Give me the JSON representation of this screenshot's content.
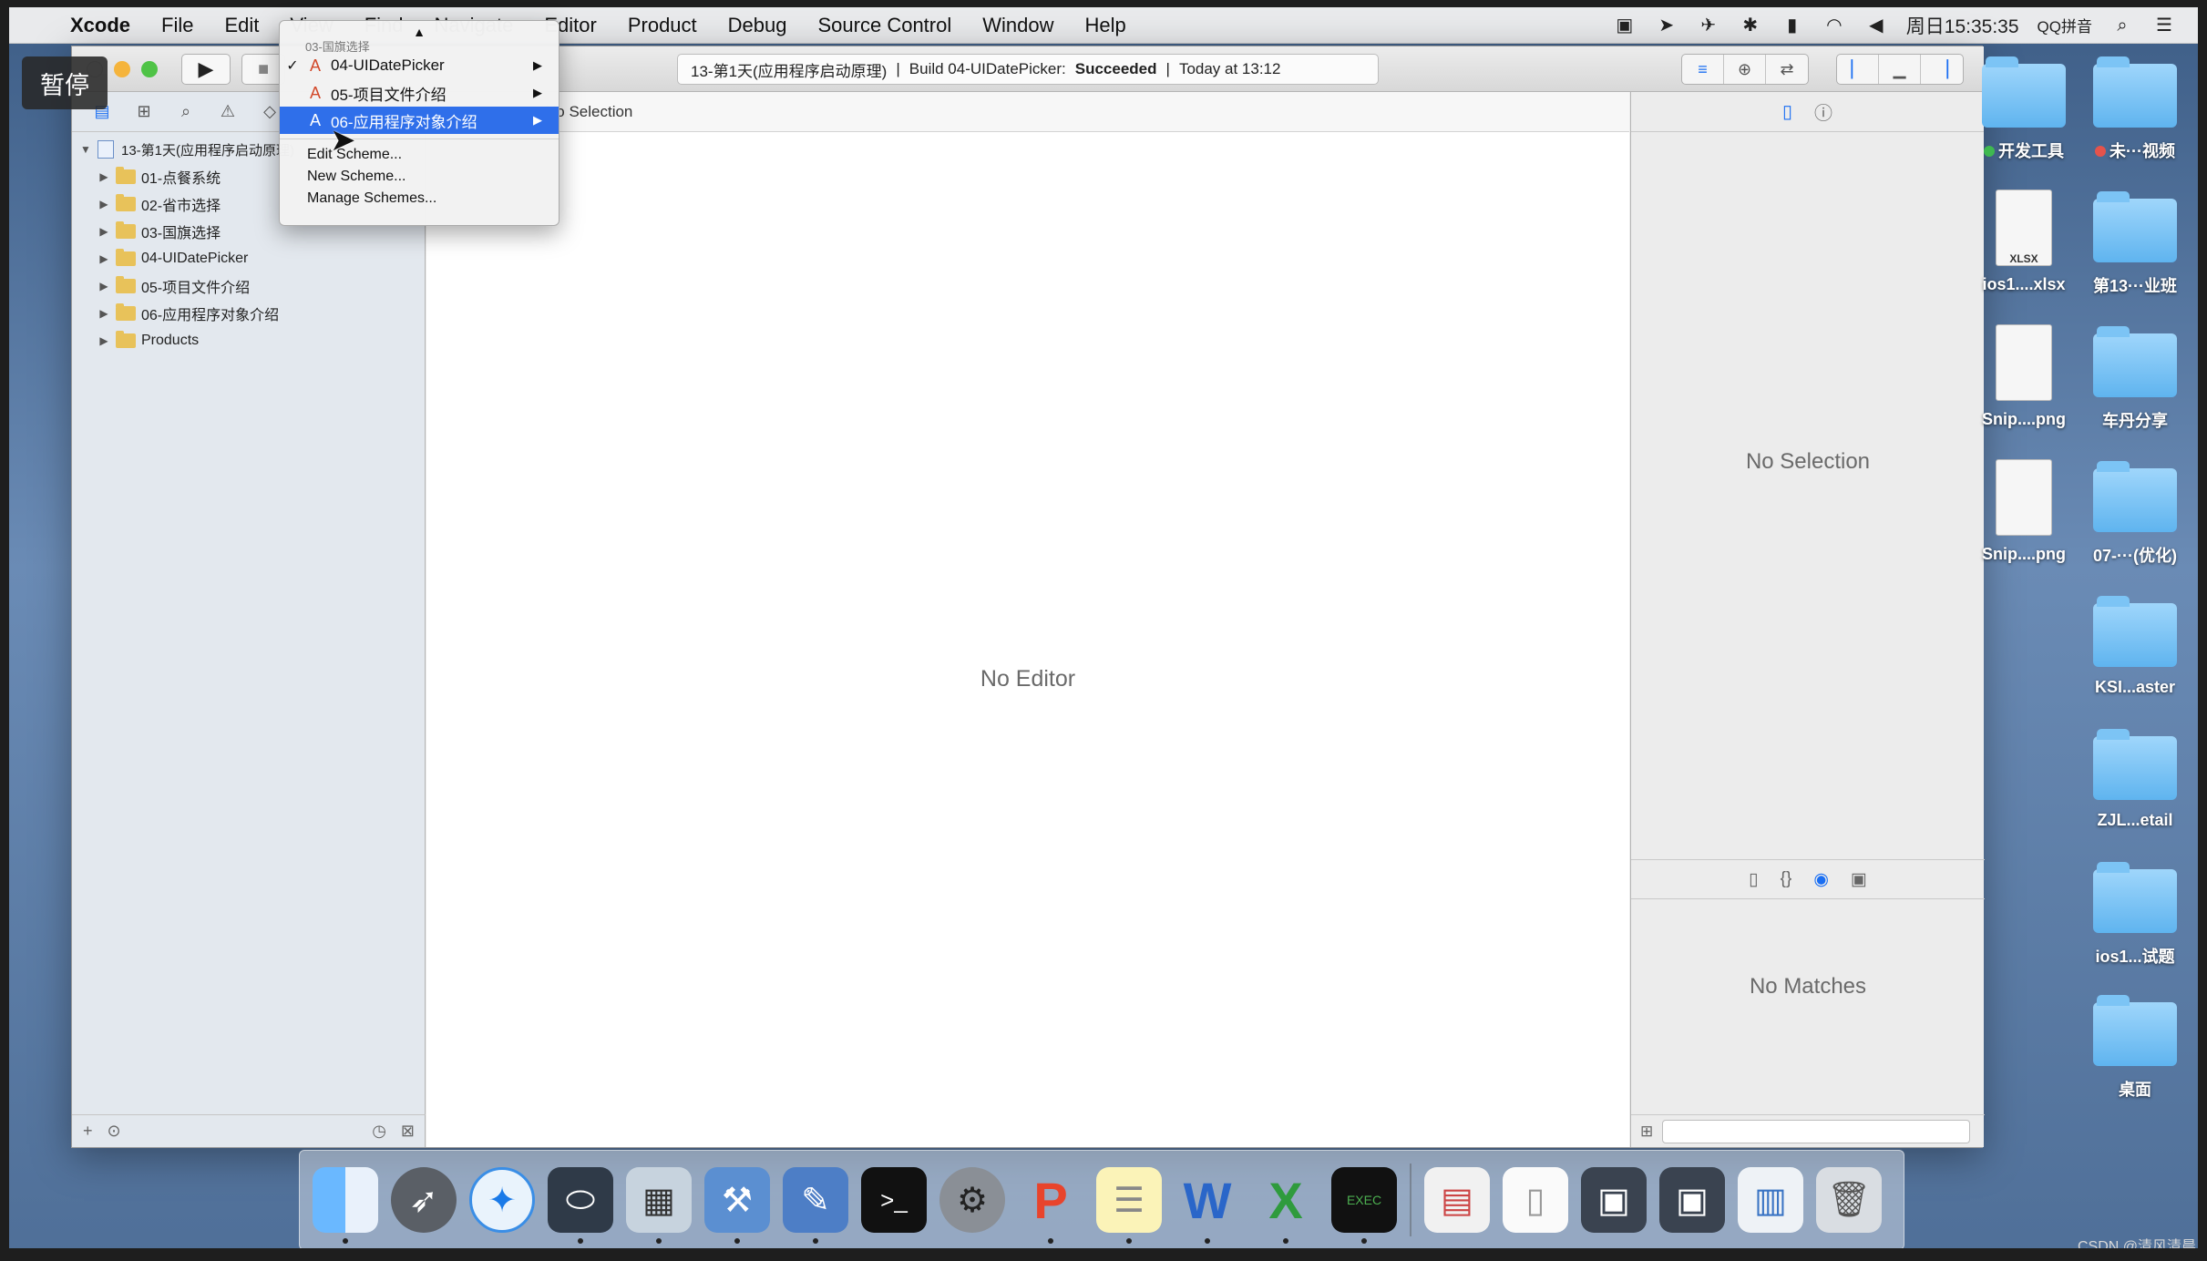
{
  "menubar": {
    "apple": "",
    "app": "Xcode",
    "items": [
      "File",
      "Edit",
      "View",
      "Find",
      "Navigate",
      "Editor",
      "Product",
      "Debug",
      "Source Control",
      "Window",
      "Help"
    ],
    "clock": "周日15:35:35",
    "input_method": "QQ拼音"
  },
  "pause_badge": "暂停",
  "toolbar": {
    "run_icon": "▶",
    "stop_icon": "■",
    "activity_project": "13-第1天(应用程序启动原理)",
    "activity_sep1": "|",
    "activity_build": "Build 04-UIDatePicker:",
    "activity_status": "Succeeded",
    "activity_sep2": "|",
    "activity_time": "Today at 13:12"
  },
  "scheme_menu": {
    "scroll_up": "▲",
    "partial_item": "03-国旗选择",
    "items": [
      {
        "label": "04-UIDatePicker",
        "checked": "✓"
      },
      {
        "label": "05-项目文件介绍",
        "checked": ""
      },
      {
        "label": "06-应用程序对象介绍",
        "checked": ""
      }
    ],
    "submenu_arrow": "▶",
    "actions": [
      "Edit Scheme...",
      "New Scheme...",
      "Manage Schemes..."
    ]
  },
  "navigator": {
    "project": "13-第1天(应用程序启动原理)",
    "items": [
      "01-点餐系统",
      "02-省市选择",
      "03-国旗选择",
      "04-UIDatePicker",
      "05-项目文件介绍",
      "06-应用程序对象介绍",
      "Products"
    ],
    "add_icon": "+"
  },
  "editor": {
    "jumpbar": "No Selection",
    "placeholder": "No Editor"
  },
  "utilities": {
    "inspector_empty": "No Selection",
    "library_empty": "No Matches"
  },
  "desktop_icons": [
    {
      "label": "开发工具",
      "kind": "folder",
      "tag": "#3fb950"
    },
    {
      "label": "未···视频",
      "kind": "folder",
      "tag": "#e5534b"
    },
    {
      "label": "ios1....xlsx",
      "kind": "file",
      "tag": ""
    },
    {
      "label": "第13···业班",
      "kind": "folder",
      "tag": ""
    },
    {
      "label": "Snip....png",
      "kind": "file",
      "tag": ""
    },
    {
      "label": "车丹分享",
      "kind": "folder",
      "tag": ""
    },
    {
      "label": "Snip....png",
      "kind": "file",
      "tag": ""
    },
    {
      "label": "07-···(优化)",
      "kind": "folder",
      "tag": ""
    },
    {
      "label": "KSI...aster",
      "kind": "folder",
      "tag": ""
    },
    {
      "label": "ZJL...etail",
      "kind": "folder",
      "tag": ""
    },
    {
      "label": "ios1...试题",
      "kind": "folder",
      "tag": ""
    },
    {
      "label": "桌面",
      "kind": "folder",
      "tag": ""
    }
  ],
  "file_badge": "XLSX",
  "watermark": "CSDN @清风清晨"
}
